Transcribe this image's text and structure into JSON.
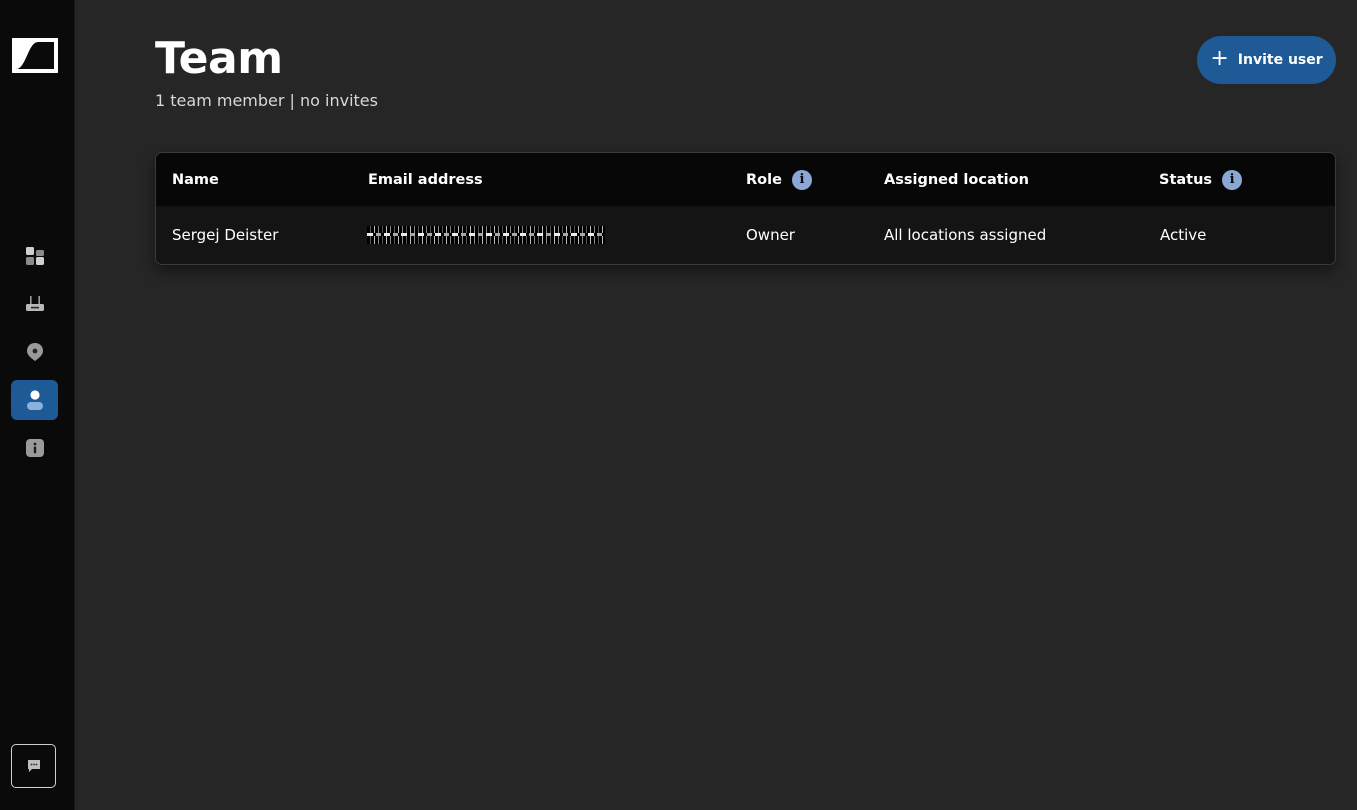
{
  "page": {
    "title": "Team",
    "subtitle": "1 team member | no invites",
    "invite_button": {
      "label": "Invite user",
      "icon": "plus-icon"
    }
  },
  "sidebar": {
    "logo": "brand-logo",
    "items": [
      {
        "icon": "dashboard-icon",
        "active": false
      },
      {
        "icon": "device-icon",
        "active": false
      },
      {
        "icon": "location-pin-icon",
        "active": false
      },
      {
        "icon": "user-icon",
        "active": true
      },
      {
        "icon": "info-icon",
        "active": false
      }
    ],
    "chat_button": {
      "icon": "chat-icon"
    }
  },
  "table": {
    "columns": [
      {
        "label": "Name",
        "info": false
      },
      {
        "label": "Email address",
        "info": false
      },
      {
        "label": "Role",
        "info": true
      },
      {
        "label": "Assigned location",
        "info": false
      },
      {
        "label": "Status",
        "info": true
      }
    ],
    "rows": [
      {
        "name": "Sergej Deister",
        "email": "",
        "email_redacted": true,
        "role": "Owner",
        "assigned_location": "All locations assigned",
        "status": "Active"
      }
    ]
  },
  "colors": {
    "accent": "#1e5a96",
    "background": "#262626",
    "sidebar": "#0a0a0a",
    "info_icon": "#8aa8d6"
  }
}
